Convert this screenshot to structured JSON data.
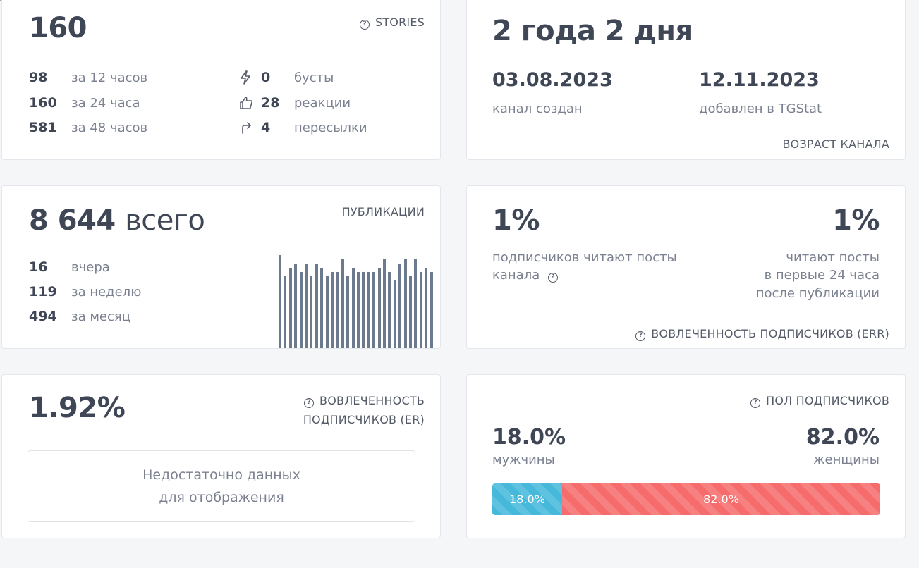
{
  "stories": {
    "total": "160",
    "header": "STORIES",
    "rows": [
      {
        "value": "98",
        "label": "за 12 часов"
      },
      {
        "value": "160",
        "label": "за 24 часа"
      },
      {
        "value": "581",
        "label": "за 48 часов"
      }
    ],
    "stats": [
      {
        "icon": "lightning-icon",
        "value": "0",
        "label": "бусты"
      },
      {
        "icon": "thumbs-up-icon",
        "value": "28",
        "label": "реакции"
      },
      {
        "icon": "share-arrow-icon",
        "value": "4",
        "label": "пересылки"
      }
    ]
  },
  "age": {
    "value": "2 года 2 дня",
    "created_date": "03.08.2023",
    "created_label": "канал создан",
    "added_date": "12.11.2023",
    "added_label": "добавлен в TGStat",
    "header": "ВОЗРАСТ КАНАЛА"
  },
  "publications": {
    "total": "8 644",
    "total_suffix": "всего",
    "header": "ПУБЛИКАЦИИ",
    "rows": [
      {
        "value": "16",
        "label": "вчера"
      },
      {
        "value": "119",
        "label": "за неделю"
      },
      {
        "value": "494",
        "label": "за месяц"
      }
    ],
    "chart_data": {
      "type": "bar",
      "values": [
        22,
        17,
        19,
        20,
        18,
        20,
        17,
        20,
        19,
        17,
        18,
        18,
        21,
        17,
        19,
        18,
        18,
        18,
        18,
        19,
        21,
        18,
        16,
        20,
        21,
        17,
        21,
        18,
        19,
        18
      ],
      "color": "#6b7a8c"
    }
  },
  "err": {
    "value_left": "1%",
    "label_left_1": "подписчиков читают посты",
    "label_left_2": "канала",
    "value_right": "1%",
    "label_right_1": "читают посты",
    "label_right_2": "в первые 24 часа",
    "label_right_3": "после публикации",
    "header": "ВОВЛЕЧЕННОСТЬ ПОДПИСЧИКОВ (ERR)"
  },
  "er": {
    "value": "1.92%",
    "header_1": "ВОВЛЕЧЕННОСТЬ",
    "header_2": "ПОДПИСЧИКОВ (ER)",
    "nodata_1": "Недостаточно данных",
    "nodata_2": "для отображения"
  },
  "gender": {
    "header": "ПОЛ ПОДПИСЧИКОВ",
    "male_value": "18.0%",
    "male_label": "мужчины",
    "female_value": "82.0%",
    "female_label": "женщины",
    "male_fraction": 0.18,
    "female_fraction": 0.82,
    "male_bar_label": "18.0%",
    "female_bar_label": "82.0%",
    "male_color": "#46b8da",
    "female_color": "#f66b6b"
  }
}
